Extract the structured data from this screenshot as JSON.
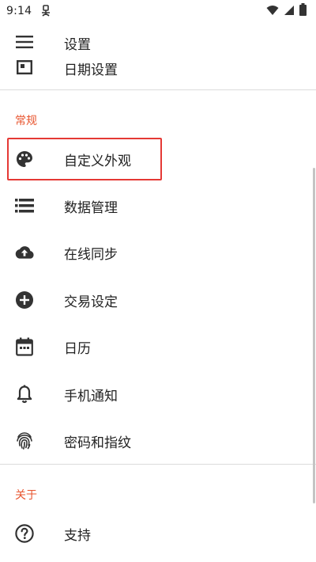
{
  "status_bar": {
    "time": "9:14",
    "icons": [
      "notification-icon",
      "wifi-icon",
      "signal-icon",
      "battery-icon"
    ]
  },
  "header": {
    "title": "设置",
    "date_settings": "日期设置"
  },
  "sections": {
    "general_title": "常规",
    "about_title": "关于"
  },
  "menu": {
    "appearance": "自定义外观",
    "data_management": "数据管理",
    "online_sync": "在线同步",
    "transaction_settings": "交易设定",
    "calendar": "日历",
    "phone_notification": "手机通知",
    "password_fingerprint": "密码和指纹",
    "support": "支持"
  },
  "colors": {
    "accent": "#e8542e",
    "highlight_border": "#e53935",
    "icon": "#333333"
  }
}
